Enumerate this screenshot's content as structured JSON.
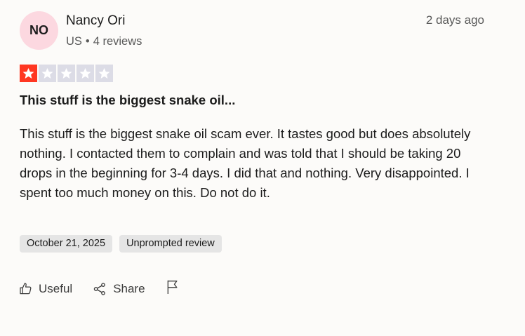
{
  "reviewer": {
    "initials": "NO",
    "name": "Nancy Ori",
    "country": "US",
    "review_count": "4 reviews",
    "avatar_color": "#fcd8e0"
  },
  "posted_ago": "2 days ago",
  "rating": {
    "value": 1,
    "max": 5,
    "filled_color": "#ff3722",
    "empty_color": "#dcdce6"
  },
  "review": {
    "title": "This stuff is the biggest snake oil...",
    "body": "This stuff is the biggest snake oil scam ever. It tastes good but does absolutely nothing. I contacted them to complain and was told that I should be taking 20 drops in the beginning for 3-4 days. I did that and nothing. Very disappointed. I spent too much money on this. Do not do it."
  },
  "tags": {
    "date": "October 21, 2025",
    "type": "Unprompted review"
  },
  "actions": {
    "useful_label": "Useful",
    "share_label": "Share",
    "useful_icon": "thumbs-up-icon",
    "share_icon": "share-icon",
    "flag_icon": "flag-icon"
  }
}
